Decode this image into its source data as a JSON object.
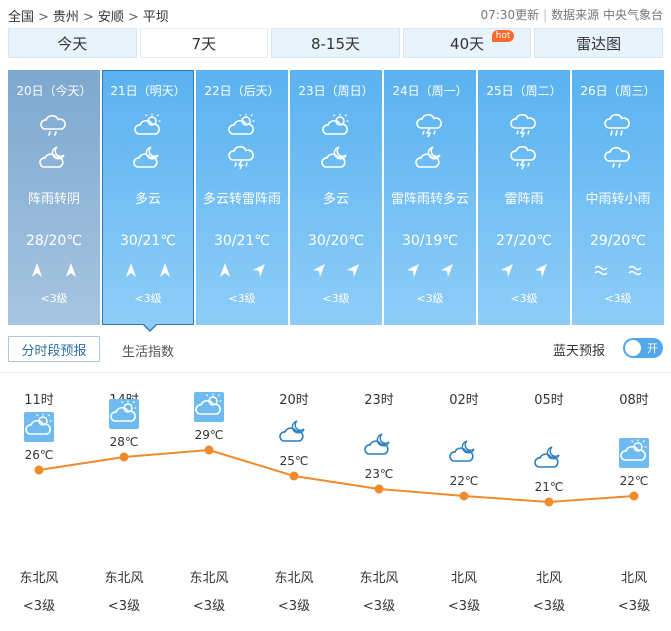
{
  "breadcrumb": [
    "全国",
    "贵州",
    "安顺",
    "平坝"
  ],
  "update_time": "07:30更新",
  "source": "数据来源 中央气象台",
  "tabs": [
    {
      "label": "今天"
    },
    {
      "label": "7天",
      "active": true
    },
    {
      "label": "8-15天"
    },
    {
      "label": "40天",
      "badge": "hot"
    },
    {
      "label": "雷达图"
    }
  ],
  "days": [
    {
      "date": "20日（今天）",
      "icon_day": "light-rain-icon",
      "icon_night": "cloudy-night-icon",
      "desc": "阵雨转阴",
      "temp": "28/20℃",
      "wind_dirs": [
        "north-arrow",
        "north-arrow"
      ],
      "level": "<3级",
      "state": "past"
    },
    {
      "date": "21日（明天）",
      "icon_day": "partly-cloudy-icon",
      "icon_night": "cloudy-night-icon",
      "desc": "多云",
      "temp": "30/21℃",
      "wind_dirs": [
        "north-arrow",
        "north-arrow"
      ],
      "level": "<3级",
      "state": "selected"
    },
    {
      "date": "22日（后天）",
      "icon_day": "partly-cloudy-icon",
      "icon_night": "thunder-rain-icon",
      "desc": "多云转雷阵雨",
      "temp": "30/21℃",
      "wind_dirs": [
        "north-arrow",
        "northeast-arrow"
      ],
      "level": "<3级"
    },
    {
      "date": "23日（周日）",
      "icon_day": "partly-cloudy-icon",
      "icon_night": "cloudy-night-icon",
      "desc": "多云",
      "temp": "30/20℃",
      "wind_dirs": [
        "northeast-arrow",
        "northeast-arrow"
      ],
      "level": "<3级"
    },
    {
      "date": "24日（周一）",
      "icon_day": "thunder-rain-icon",
      "icon_night": "cloudy-night-icon",
      "desc": "雷阵雨转多云",
      "temp": "30/19℃",
      "wind_dirs": [
        "northeast-arrow",
        "northeast-arrow"
      ],
      "level": "<3级"
    },
    {
      "date": "25日（周二）",
      "icon_day": "thunder-rain-icon",
      "icon_night": "thunder-rain-icon",
      "desc": "雷阵雨",
      "temp": "27/20℃",
      "wind_dirs": [
        "northeast-arrow",
        "northeast-arrow"
      ],
      "level": "<3级"
    },
    {
      "date": "26日（周三）",
      "icon_day": "moderate-rain-icon",
      "icon_night": "light-rain-icon",
      "desc": "中雨转小雨",
      "temp": "29/20℃",
      "wind_dirs": [
        "variable-wind",
        "variable-wind"
      ],
      "level": "<3级"
    }
  ],
  "subtabs": {
    "hourly": "分时段预报",
    "life": "生活指数"
  },
  "bluesky": {
    "label": "蓝天预报",
    "toggle": "开"
  },
  "hourly": [
    {
      "time": "11时",
      "icon": "partly-cloudy-icon",
      "temp": "26℃",
      "t": 26,
      "wind": "东北风",
      "level": "<3级"
    },
    {
      "time": "14时",
      "icon": "partly-cloudy-icon",
      "temp": "28℃",
      "t": 28,
      "wind": "东北风",
      "level": "<3级"
    },
    {
      "time": "17时",
      "icon": "partly-cloudy-icon",
      "temp": "29℃",
      "t": 29,
      "wind": "东北风",
      "level": "<3级"
    },
    {
      "time": "20时",
      "icon": "cloudy-night-icon",
      "temp": "25℃",
      "t": 25,
      "wind": "东北风",
      "level": "<3级"
    },
    {
      "time": "23时",
      "icon": "cloudy-night-icon",
      "temp": "23℃",
      "t": 23,
      "wind": "东北风",
      "level": "<3级"
    },
    {
      "time": "02时",
      "icon": "cloudy-night-icon",
      "temp": "22℃",
      "t": 22,
      "wind": "北风",
      "level": "<3级"
    },
    {
      "time": "05时",
      "icon": "cloudy-night-icon",
      "temp": "21℃",
      "t": 21,
      "wind": "北风",
      "level": "<3级"
    },
    {
      "time": "08时",
      "icon": "partly-cloudy-icon",
      "temp": "22℃",
      "t": 22,
      "wind": "北风",
      "level": "<3级"
    }
  ],
  "colors": {
    "accent": "#53a7ea",
    "curve": "#f08a2c",
    "card": "#5ab2f0"
  }
}
